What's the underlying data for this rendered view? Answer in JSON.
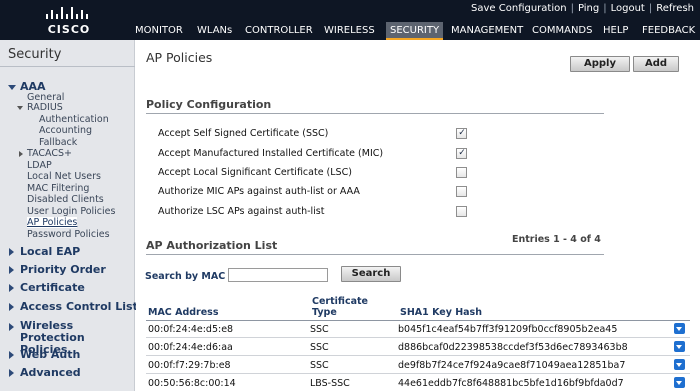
{
  "brand": {
    "logo_text": "CISCO"
  },
  "top_links": {
    "save_configuration": "Save Configuration",
    "ping": "Ping",
    "logout": "Logout",
    "refresh": "Refresh"
  },
  "menu": [
    {
      "label": "MONITOR",
      "active": false
    },
    {
      "label": "WLANs",
      "active": false
    },
    {
      "label": "CONTROLLER",
      "active": false
    },
    {
      "label": "WIRELESS",
      "active": false
    },
    {
      "label": "SECURITY",
      "active": true
    },
    {
      "label": "MANAGEMENT",
      "active": false
    },
    {
      "label": "COMMANDS",
      "active": false
    },
    {
      "label": "HELP",
      "active": false
    },
    {
      "label": "FEEDBACK",
      "active": false
    }
  ],
  "sidebar": {
    "title": "Security",
    "aaa": {
      "label": "AAA",
      "general": "General",
      "radius": {
        "label": "RADIUS",
        "authentication": "Authentication",
        "accounting": "Accounting",
        "fallback": "Fallback"
      },
      "tacacs": "TACACS+",
      "ldap": "LDAP",
      "local_net_users": "Local Net Users",
      "mac_filtering": "MAC Filtering",
      "disabled_clients": "Disabled Clients",
      "user_login_policies": "User Login Policies",
      "ap_policies": "AP Policies",
      "password_policies": "Password Policies"
    },
    "sections": [
      "Local EAP",
      "Priority Order",
      "Certificate",
      "Access Control Lists",
      "Wireless Protection Policies",
      "Web Auth",
      "Advanced"
    ]
  },
  "main": {
    "title": "AP Policies",
    "apply_label": "Apply",
    "add_label": "Add",
    "policy_section_title": "Policy Configuration",
    "policies": [
      {
        "label": "Accept Self Signed Certificate (SSC)",
        "checked": true
      },
      {
        "label": "Accept Manufactured Installed Certificate (MIC)",
        "checked": true
      },
      {
        "label": "Accept Local Significant Certificate (LSC)",
        "checked": false
      },
      {
        "label": "Authorize MIC APs against auth-list or AAA",
        "checked": false
      },
      {
        "label": "Authorize LSC APs against auth-list",
        "checked": false
      }
    ],
    "auth_list_title": "AP Authorization List",
    "entries_text": "Entries 1 - 4 of 4",
    "search_label": "Search by MAC",
    "search_value": "",
    "search_button": "Search",
    "table": {
      "headers": {
        "mac": "MAC Address",
        "type_line1": "Certificate",
        "type_line2": "Type",
        "hash": "SHA1 Key Hash"
      },
      "rows": [
        {
          "mac": "00:0f:24:4e:d5:e8",
          "type": "SSC",
          "hash": "b045f1c4eaf54b7ff3f91209fb0ccf8905b2ea45"
        },
        {
          "mac": "00:0f:24:4e:d6:aa",
          "type": "SSC",
          "hash": "d886bcaf0d22398538ccdef3f53d6ec7893463b8"
        },
        {
          "mac": "00:0f:f7:29:7b:e8",
          "type": "SSC",
          "hash": "de9f8b7f24ce7f924a9cae8f71049aea12851ba7"
        },
        {
          "mac": "00:50:56:8c:00:14",
          "type": "LBS-SSC",
          "hash": "44e61eddb7fc8f648881bc5bfe1d16bf9bfda0d7"
        }
      ]
    }
  },
  "colors": {
    "topbar": "#0e1624",
    "active_tab": "#5d6470",
    "active_underline": "#f5a623",
    "sidebar_bg": "#e4e6ea",
    "link_blue": "#1f3a63",
    "dropdown_blue": "#1e6fd0"
  }
}
